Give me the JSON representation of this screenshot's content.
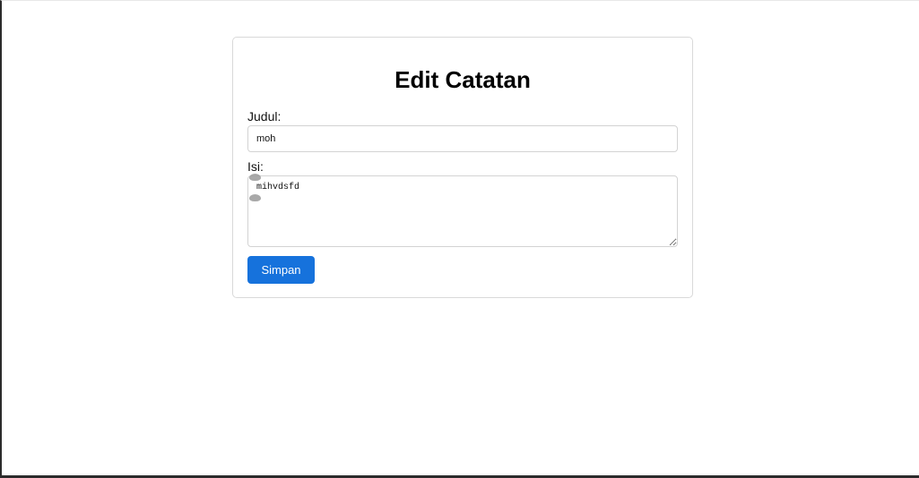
{
  "page": {
    "title": "Edit Catatan"
  },
  "form": {
    "judul_label": "Judul:",
    "judul_value": "moh",
    "isi_label": "Isi:",
    "isi_value": "mihvdsfd",
    "submit_label": "Simpan"
  },
  "colors": {
    "button": "#1672dc",
    "border": "#d3d3d3"
  }
}
